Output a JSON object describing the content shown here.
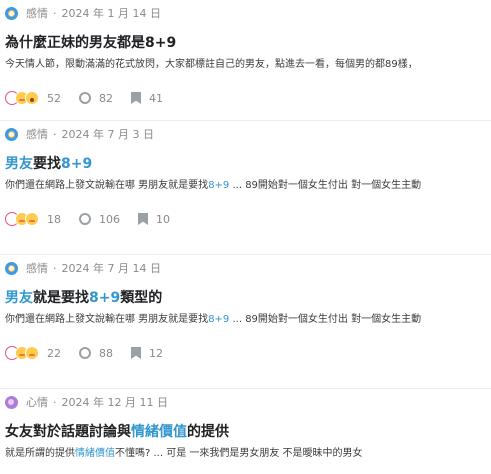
{
  "posts": [
    {
      "board": "感情",
      "board_icon": "love-board-icon",
      "date": "2024 年 1 月 14 日",
      "title_parts": [
        "為什麼正妹的男友都是8+9"
      ],
      "excerpt_parts": [
        "今天情人節，限動滿滿的花式放閃，大家都標註自己的男友，點進去一看，每個男的都89樣，"
      ],
      "reactions": [
        "heart",
        "blush",
        "wow"
      ],
      "reaction_count": "52",
      "comment_count": "82",
      "bookmark_count": "41"
    },
    {
      "board": "感情",
      "board_icon": "love-board-icon",
      "date": "2024 年 7 月 3 日",
      "title_parts": [
        "男友",
        "要找",
        "8+9"
      ],
      "excerpt_parts": [
        "你們還在網路上發文說輸在哪 男朋友就是要找",
        "8+9",
        " ... 89開始對一個女生付出 對一個女生主動"
      ],
      "reactions": [
        "heart",
        "blush",
        "blush"
      ],
      "reaction_count": "18",
      "comment_count": "106",
      "bookmark_count": "10"
    },
    {
      "board": "感情",
      "board_icon": "love-board-icon",
      "date": "2024 年 7 月 14 日",
      "title_parts": [
        "男友",
        "就是要找",
        "8+9",
        "類型的"
      ],
      "excerpt_parts": [
        "你們還在網路上發文說輸在哪 男朋友就是要找",
        "8+9",
        " ... 89開始對一個女生付出 對一個女生主動"
      ],
      "reactions": [
        "heart",
        "blush",
        "blush"
      ],
      "reaction_count": "22",
      "comment_count": "88",
      "bookmark_count": "12"
    },
    {
      "board": "心情",
      "board_icon": "mood-board-icon",
      "date": "2024 年 12 月 11 日",
      "title_parts": [
        "女友對於話題討論與",
        "情緒價值",
        "的提供"
      ],
      "excerpt_parts": [
        "就是所謂的提供",
        "情緒價值",
        "不懂嗎? ... 可是 一來我們是男女朋友 不是曖昧中的男女"
      ]
    }
  ],
  "colors": {
    "highlight": "#3397cf",
    "meta_text": "#8a8a8a",
    "title_text": "#202124",
    "love_board": "#3b9be6",
    "mood_board": "#a97fd7"
  }
}
